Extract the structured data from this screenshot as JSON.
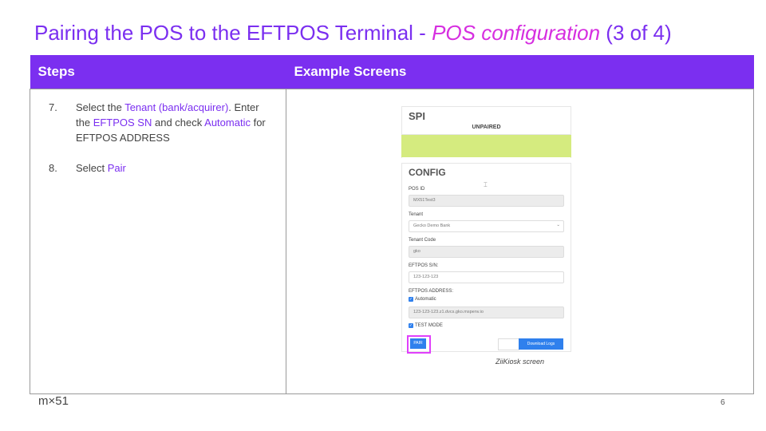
{
  "slide": {
    "title_part1": "Pairing the POS to the EFTPOS Terminal - ",
    "title_accent": "POS configuration",
    "title_part3": " (3 of 4)",
    "accent_color": "#7b2ff0",
    "highlight_color": "#d62ee0"
  },
  "table": {
    "col1_header": "Steps",
    "col2_header": "Example Screens"
  },
  "steps": [
    {
      "num": "7.",
      "t1": "Select the ",
      "h1": "Tenant (bank/acquirer)",
      "t2": ". Enter the ",
      "h2": "EFTPOS SN",
      "t3": " and check ",
      "h3": "Automatic",
      "t4": " for EFTPOS ADDRESS"
    },
    {
      "num": "8.",
      "t1": "Select ",
      "h1": "Pair"
    }
  ],
  "screen": {
    "spi_title": "SPI",
    "status": "UNPAIRED",
    "status_color": "#d5eb7f",
    "config_title": "CONFIG",
    "pos_id_label": "POS ID",
    "pos_id_value": "MX51Test3",
    "tenant_label": "Tenant",
    "tenant_value": "Gecko Demo Bank",
    "tenant_code_label": "Tenant Code",
    "tenant_code_value": "gko",
    "eftpos_sn_label": "EFTPOS S/N:",
    "eftpos_sn_value": "123-123-123",
    "eftpos_address_label": "EFTPOS ADDRESS:",
    "automatic_label": "Automatic",
    "address_value": "123-123-123.z1.dvcs.gko.mspenv.io",
    "test_mode_label": "TEST MODE",
    "pair_button": "PAIR",
    "download_button": "Download Logs",
    "button_color": "#2f80ed"
  },
  "caption": "ZiiKiosk screen",
  "footer": {
    "logo": "m×51",
    "page_number": "6"
  }
}
